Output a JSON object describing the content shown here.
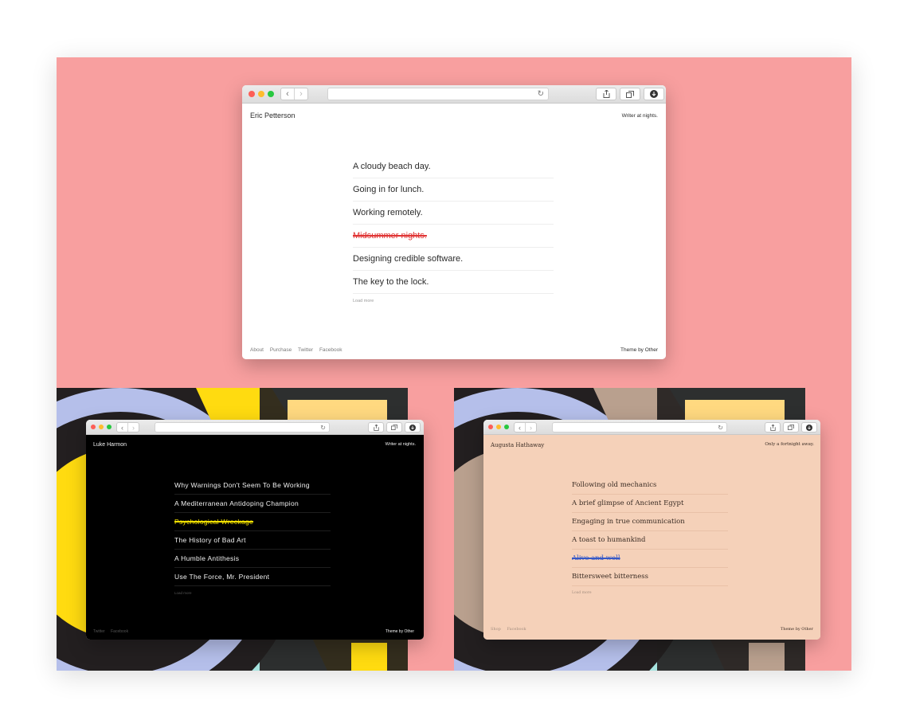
{
  "windows": [
    {
      "site_name": "Eric Petterson",
      "tagline": "Writer at nights.",
      "posts": [
        {
          "title": "A cloudy beach day.",
          "struck": false
        },
        {
          "title": "Going in for lunch.",
          "struck": false
        },
        {
          "title": "Working remotely.",
          "struck": false
        },
        {
          "title": "Midsummer nights.",
          "struck": true
        },
        {
          "title": "Designing credible software.",
          "struck": false
        },
        {
          "title": "The key to the lock.",
          "struck": false
        }
      ],
      "load_more": "Load more",
      "footer_links": [
        "About",
        "Purchase",
        "Twitter",
        "Facebook"
      ],
      "credit": "Theme by Other",
      "colors": {
        "bg": "#ffffff",
        "text": "#2b2b2b",
        "muted": "#8a8a8a",
        "divider": "#eeeeee",
        "strike": "#e03333"
      }
    },
    {
      "site_name": "Luke Harmon",
      "tagline": "Writer at nights.",
      "posts": [
        {
          "title": "Why Warnings Don't Seem To Be Working",
          "struck": false
        },
        {
          "title": "A Mediterranean Antidoping Champion",
          "struck": false
        },
        {
          "title": "Psychological Wreckage",
          "struck": true
        },
        {
          "title": "The History of Bad Art",
          "struck": false
        },
        {
          "title": "A Humble Antithesis",
          "struck": false
        },
        {
          "title": "Use The Force, Mr. President",
          "struck": false
        }
      ],
      "load_more": "Load more",
      "footer_links": [
        "Twitter",
        "Facebook"
      ],
      "credit": "Theme by Other",
      "colors": {
        "bg": "#000000",
        "text": "#f0f0f0",
        "muted": "#555555",
        "divider": "#1e1e1e",
        "strike": "#f2e000"
      }
    },
    {
      "site_name": "Augusta Hathaway",
      "tagline": "Only a fortnight away.",
      "posts": [
        {
          "title": "Following old mechanics",
          "struck": false
        },
        {
          "title": "A brief glimpse of Ancient Egypt",
          "struck": false
        },
        {
          "title": "Engaging in true communication",
          "struck": false
        },
        {
          "title": "A toast to humankind",
          "struck": false
        },
        {
          "title": "Alive and well",
          "struck": true
        },
        {
          "title": "Bittersweet bitterness",
          "struck": false
        }
      ],
      "load_more": "Load more",
      "footer_links": [
        "Shop",
        "Facebook"
      ],
      "credit": "Theme by Other",
      "colors": {
        "bg": "#f5d1b9",
        "text": "#3a2c24",
        "muted": "#a58f80",
        "divider": "#e9c1a7",
        "strike": "#3558c7"
      }
    }
  ],
  "background_colors": {
    "pink": "#f89f9f",
    "dark": "#231f20",
    "mint": "#a6e3df",
    "lavender": "#b5bfea",
    "yellow": "#ffdb10",
    "peach": "#ffd980",
    "taupe": "#b9a08e"
  },
  "icons": {
    "reload": "reload-icon",
    "share": "share-icon",
    "tabs": "tabs-icon",
    "download": "download-icon"
  }
}
